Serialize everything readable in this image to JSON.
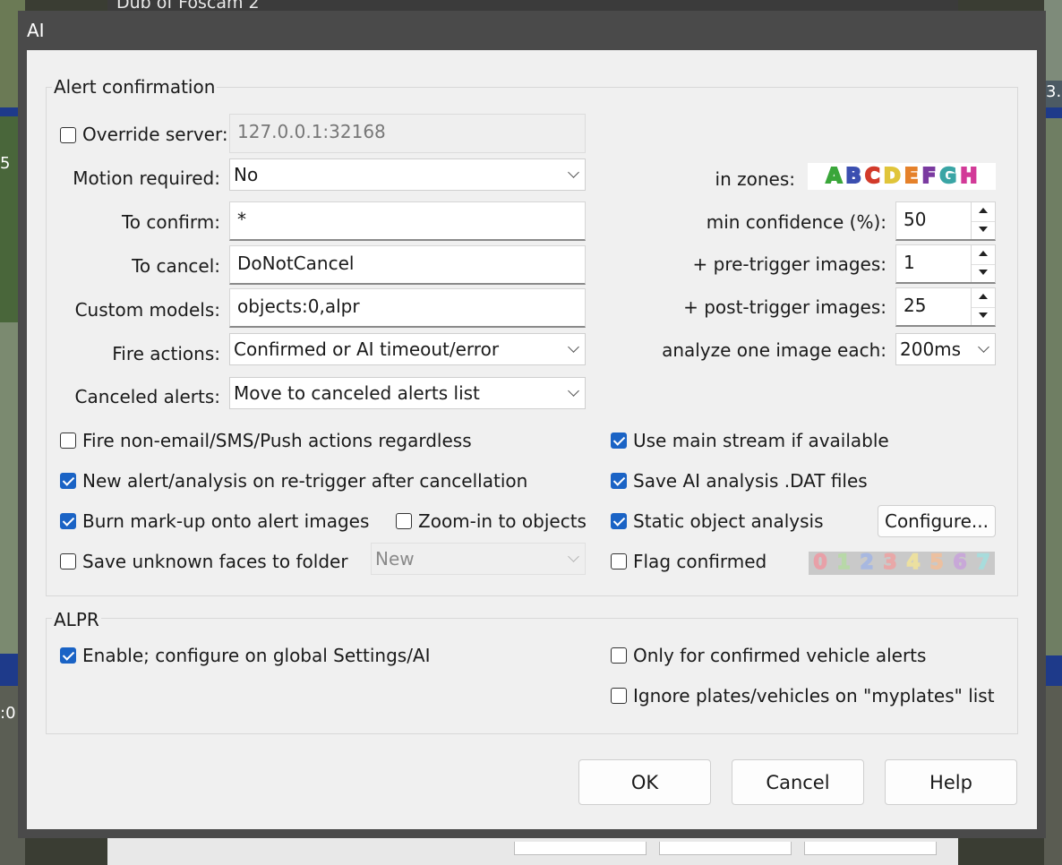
{
  "background": {
    "window_title": "Dub of Foscam 2",
    "left_edge_text_top": "5",
    "left_edge_text_bottom": ":0",
    "right_edge_text": "3."
  },
  "dialog": {
    "title": "AI",
    "alert_confirmation": {
      "group_title": "Alert confirmation",
      "override_server": {
        "label": "Override server:",
        "checked": false,
        "value": "127.0.0.1:32168"
      },
      "motion_required": {
        "label": "Motion required:",
        "value": "No"
      },
      "to_confirm": {
        "label": "To confirm:",
        "value": "*"
      },
      "to_cancel": {
        "label": "To cancel:",
        "value": "DoNotCancel"
      },
      "custom_models": {
        "label": "Custom models:",
        "value": "objects:0,alpr"
      },
      "fire_actions": {
        "label": "Fire actions:",
        "value": "Confirmed or AI timeout/error"
      },
      "canceled_alerts": {
        "label": "Canceled alerts:",
        "value": "Move to canceled alerts list"
      },
      "in_zones": {
        "label": "in zones:",
        "zones": [
          {
            "letter": "A",
            "color": "#3aa63a"
          },
          {
            "letter": "B",
            "color": "#3b4fb0"
          },
          {
            "letter": "C",
            "color": "#d23a2a"
          },
          {
            "letter": "D",
            "color": "#e0c53a"
          },
          {
            "letter": "E",
            "color": "#e5812a"
          },
          {
            "letter": "F",
            "color": "#7a3aa0"
          },
          {
            "letter": "G",
            "color": "#3aa5a5"
          },
          {
            "letter": "H",
            "color": "#d23a98"
          }
        ]
      },
      "min_confidence": {
        "label": "min confidence (%):",
        "value": "50"
      },
      "pre_trigger": {
        "label": "+ pre-trigger images:",
        "value": "1"
      },
      "post_trigger": {
        "label": "+ post-trigger images:",
        "value": "25"
      },
      "analyze_each": {
        "label": "analyze one image each:",
        "value": "200ms"
      },
      "checkboxes": {
        "fire_non_email": {
          "label": "Fire non-email/SMS/Push actions regardless",
          "checked": false
        },
        "new_alert_retrigger": {
          "label": "New alert/analysis on re-trigger after cancellation",
          "checked": true
        },
        "burn_markup": {
          "label": "Burn mark-up onto alert images",
          "checked": true
        },
        "zoom_in": {
          "label": "Zoom-in to objects",
          "checked": false
        },
        "save_faces": {
          "label": "Save unknown faces to folder",
          "checked": false
        },
        "use_main_stream": {
          "label": "Use main stream if available",
          "checked": true
        },
        "save_dat": {
          "label": "Save AI analysis .DAT files",
          "checked": true
        },
        "static_object": {
          "label": "Static object analysis",
          "checked": true
        },
        "flag_confirmed": {
          "label": "Flag confirmed",
          "checked": false
        }
      },
      "faces_folder": {
        "value": "New"
      },
      "configure_label": "Configure...",
      "flags": [
        {
          "digit": "0",
          "color": "#e8a0a8"
        },
        {
          "digit": "1",
          "color": "#b8d8a8"
        },
        {
          "digit": "2",
          "color": "#a8b8e0"
        },
        {
          "digit": "3",
          "color": "#e8a8a8"
        },
        {
          "digit": "4",
          "color": "#ece0a0"
        },
        {
          "digit": "5",
          "color": "#ecc0a0"
        },
        {
          "digit": "6",
          "color": "#c8a8d8"
        },
        {
          "digit": "7",
          "color": "#a8dcdc"
        }
      ]
    },
    "alpr": {
      "group_title": "ALPR",
      "enable": {
        "label": "Enable; configure on global Settings/AI",
        "checked": true
      },
      "only_confirmed": {
        "label": "Only for confirmed vehicle alerts",
        "checked": false
      },
      "ignore_myplates": {
        "label": "Ignore plates/vehicles on \"myplates\" list",
        "checked": false
      }
    },
    "buttons": {
      "ok": "OK",
      "cancel": "Cancel",
      "help": "Help"
    }
  }
}
